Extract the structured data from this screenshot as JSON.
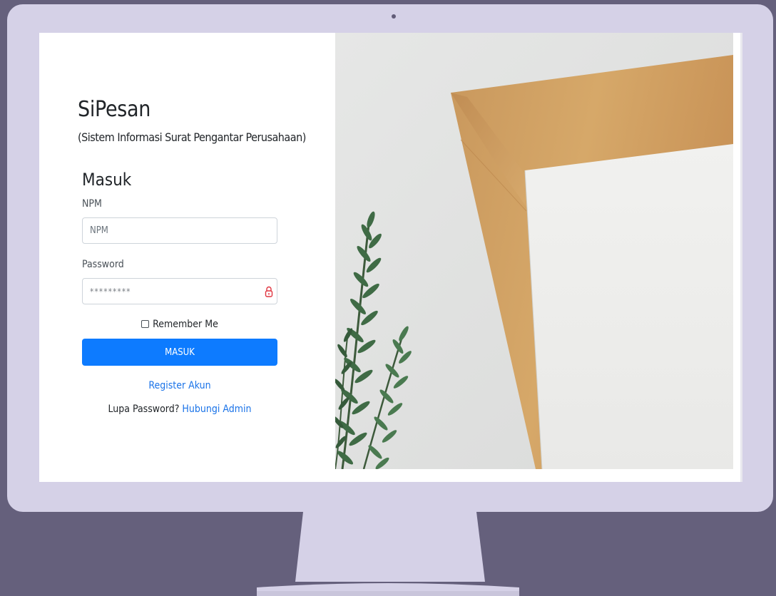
{
  "brand": {
    "title": "SiPesan",
    "subtitle": "(Sistem Informasi Surat Pengantar Perusahaan)"
  },
  "form": {
    "title": "Masuk",
    "npm": {
      "label": "NPM",
      "placeholder": "NPM"
    },
    "password": {
      "label": "Password",
      "value": "*********",
      "icon": "lock-icon"
    },
    "remember_label": "Remember Me",
    "submit_label": "MASUK",
    "register_label": "Register Akun",
    "forgot_text": "Lupa Password?",
    "contact_label": "Hubungi Admin"
  },
  "colors": {
    "background": "#65607c",
    "monitor": "#d5d1e7",
    "primary": "#0d7bff",
    "link": "#1a73e8",
    "lock_icon": "#e0343f"
  }
}
